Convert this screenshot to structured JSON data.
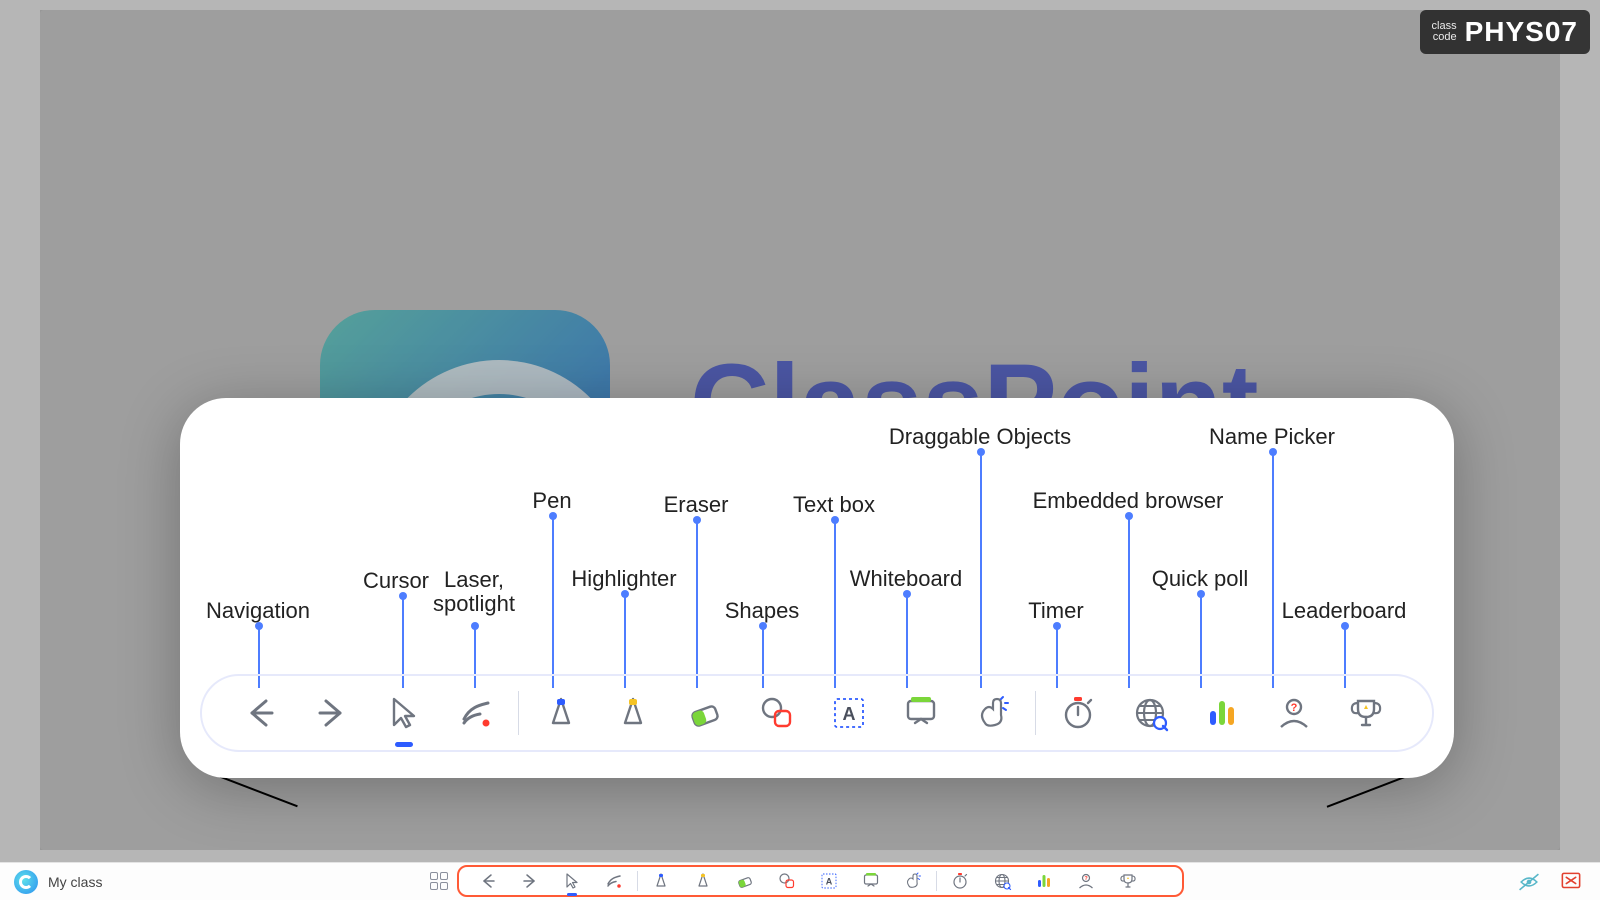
{
  "classcode": {
    "label_line1": "class",
    "label_line2": "code",
    "value": "PHYS07"
  },
  "brand": "ClassPoint",
  "bottombar": {
    "myclass": "My class"
  },
  "tools": {
    "navigation": "Navigation",
    "cursor": "Cursor",
    "laser": "Laser, spotlight",
    "pen": "Pen",
    "highlighter": "Highlighter",
    "eraser": "Eraser",
    "shapes": "Shapes",
    "textbox": "Text box",
    "whiteboard": "Whiteboard",
    "draggable": "Draggable Objects",
    "timer": "Timer",
    "browser": "Embedded browser",
    "quickpoll": "Quick poll",
    "namepicker": "Name Picker",
    "leaderboard": "Leaderboard"
  }
}
